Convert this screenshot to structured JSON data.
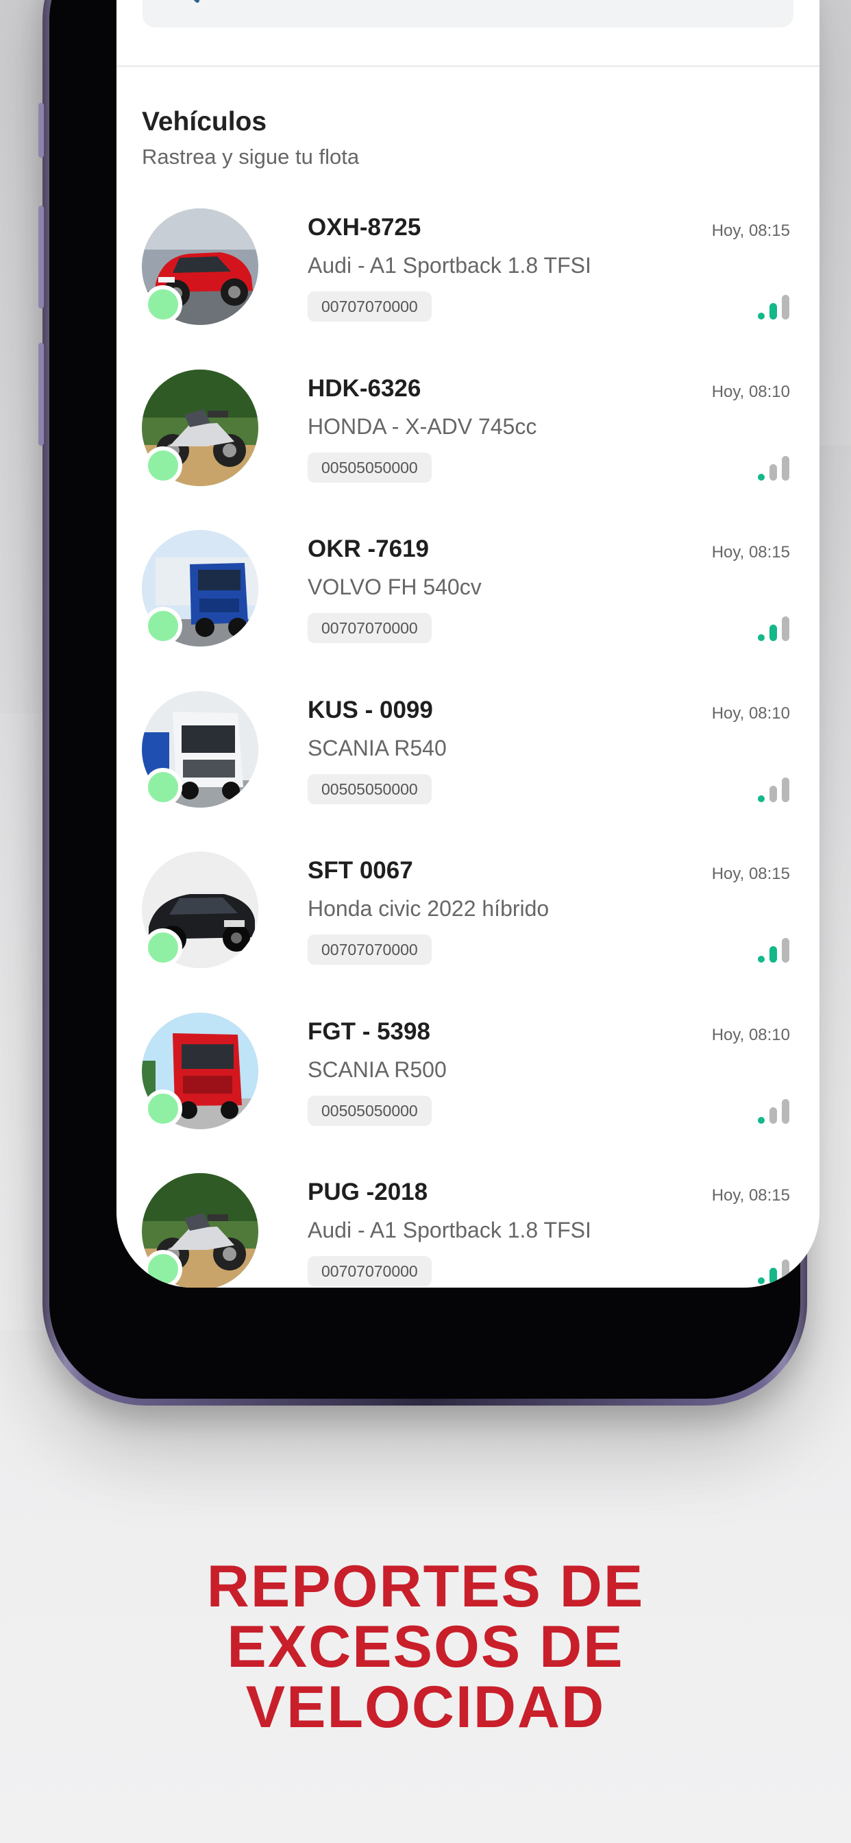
{
  "colors": {
    "accent_red": "#c81f2a",
    "status_green": "#8ff0a4",
    "signal_active": "#14b88a",
    "signal_inactive": "#b8b8b8"
  },
  "search": {
    "icon": "search-icon",
    "placeholder": ""
  },
  "section": {
    "title": "Vehículos",
    "subtitle": "Rastrea y sigue tu flota"
  },
  "vehicles": [
    {
      "plate": "OXH-8725",
      "model": "Audi - A1 Sportback 1.8 TFSI",
      "id": "00707070000",
      "time": "Hoy, 08:15",
      "signal_bars": 2,
      "image": "red-car"
    },
    {
      "plate": "HDK-6326",
      "model": "HONDA - X-ADV 745cc",
      "id": "00505050000",
      "time": "Hoy, 08:10",
      "signal_bars": 1,
      "image": "scooter"
    },
    {
      "plate": "OKR -7619",
      "model": "VOLVO FH 540cv",
      "id": "00707070000",
      "time": "Hoy, 08:15",
      "signal_bars": 2,
      "image": "blue-truck"
    },
    {
      "plate": "KUS - 0099",
      "model": "SCANIA R540",
      "id": "00505050000",
      "time": "Hoy, 08:10",
      "signal_bars": 1,
      "image": "white-truck"
    },
    {
      "plate": "SFT 0067",
      "model": "Honda civic 2022 híbrido",
      "id": "00707070000",
      "time": "Hoy, 08:15",
      "signal_bars": 2,
      "image": "black-car"
    },
    {
      "plate": "FGT - 5398",
      "model": "SCANIA R500",
      "id": "00505050000",
      "time": "Hoy, 08:10",
      "signal_bars": 1,
      "image": "red-truck"
    },
    {
      "plate": "PUG -2018",
      "model": "Audi - A1 Sportback 1.8 TFSI",
      "id": "00707070000",
      "time": "Hoy, 08:15",
      "signal_bars": 2,
      "image": "scooter"
    }
  ],
  "headline": [
    "REPORTES DE",
    "EXCESOS DE",
    "VELOCIDAD"
  ]
}
